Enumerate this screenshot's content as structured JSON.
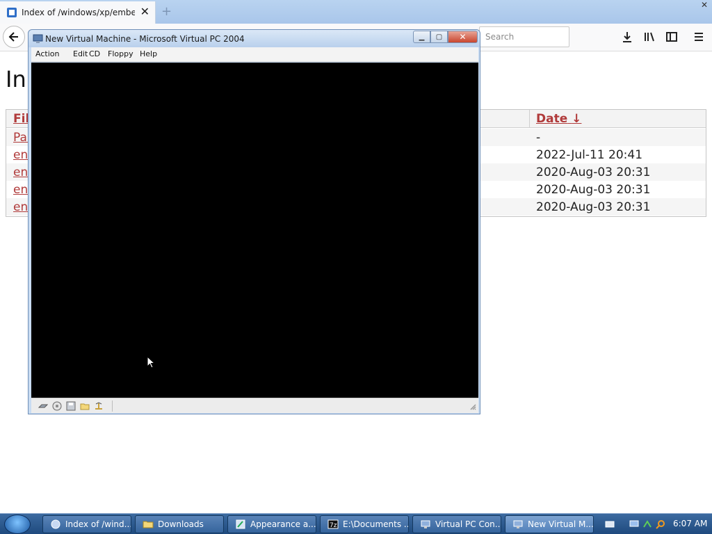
{
  "browser": {
    "tab_title": "Index of /windows/xp/embedde",
    "search_placeholder": "Search"
  },
  "page": {
    "heading": "In",
    "headers": {
      "file": "Fil",
      "date": "Date",
      "sort_indicator": "↓"
    },
    "rows": [
      {
        "name": "Par",
        "date": "-"
      },
      {
        "name": "en",
        "date": "2022-Jul-11 20:41"
      },
      {
        "name": "en",
        "date": "2020-Aug-03 20:31"
      },
      {
        "name": "en",
        "date": "2020-Aug-03 20:31"
      },
      {
        "name": "en",
        "date": "2020-Aug-03 20:31"
      }
    ]
  },
  "vpc": {
    "title": "New Virtual Machine - Microsoft Virtual PC 2004",
    "menu": [
      "Action",
      "Edit",
      "CD",
      "Floppy",
      "Help"
    ],
    "status_icons": [
      "hard-disk-icon",
      "cd-drive-icon",
      "floppy-icon",
      "shared-folder-icon",
      "network-icon"
    ]
  },
  "taskbar": {
    "buttons": [
      {
        "label": "Index of /wind...",
        "icon": "browser-icon"
      },
      {
        "label": "Downloads",
        "icon": "folder-icon"
      },
      {
        "label": "Appearance a...",
        "icon": "appearance-icon"
      },
      {
        "label": "E:\\Documents ...",
        "icon": "7zip-icon"
      },
      {
        "label": "Virtual PC Con...",
        "icon": "vpc-console-icon"
      },
      {
        "label": "New Virtual M...",
        "icon": "vpc-icon"
      }
    ],
    "clock": "6:07 AM"
  },
  "colors": {
    "link": "#b03a3a",
    "taskbar": "#2a5a92",
    "vm_screen": "#000000"
  }
}
